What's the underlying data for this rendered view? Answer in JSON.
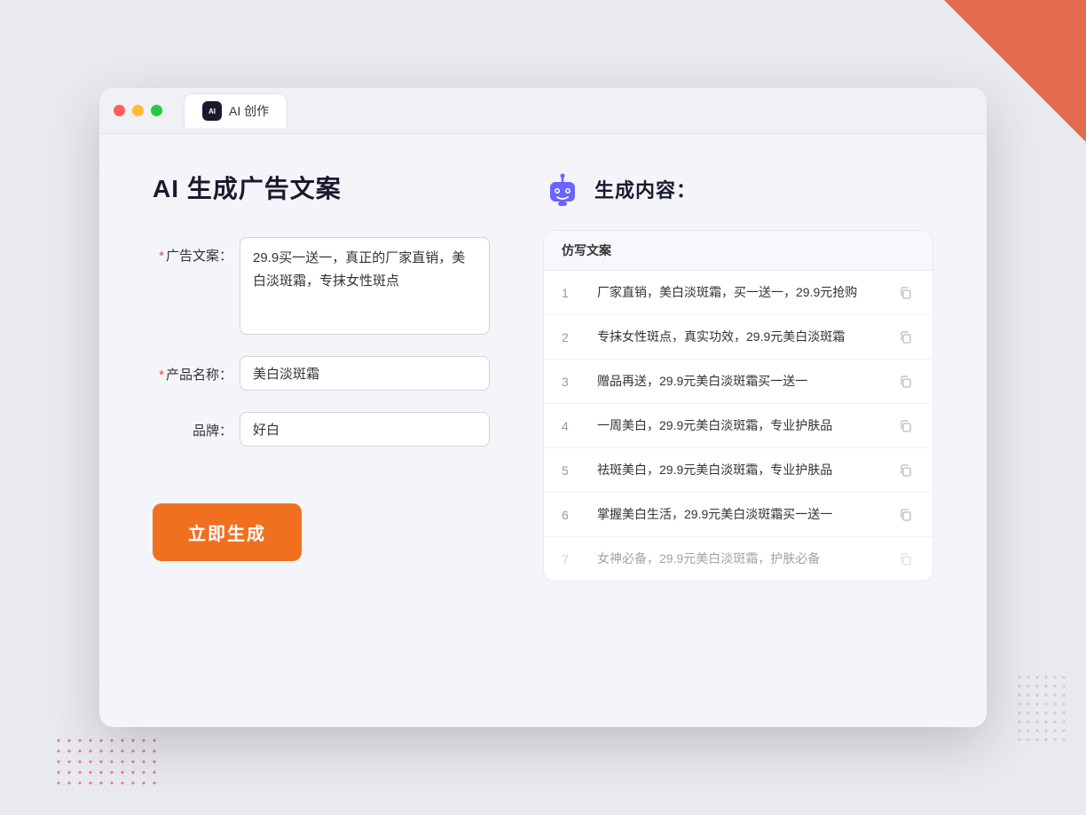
{
  "window": {
    "tab_label": "AI 创作"
  },
  "page": {
    "title": "AI 生成广告文案"
  },
  "form": {
    "ad_copy_label": "广告文案：",
    "ad_copy_required": true,
    "ad_copy_value": "29.9买一送一，真正的厂家直销，美白淡斑霜，专抹女性斑点",
    "product_name_label": "产品名称：",
    "product_name_required": true,
    "product_name_value": "美白淡斑霜",
    "brand_label": "品牌：",
    "brand_required": false,
    "brand_value": "好白",
    "generate_btn_label": "立即生成"
  },
  "results": {
    "header_title": "生成内容：",
    "column_label": "仿写文案",
    "items": [
      {
        "num": 1,
        "text": "厂家直销，美白淡斑霜，买一送一，29.9元抢购",
        "faded": false
      },
      {
        "num": 2,
        "text": "专抹女性斑点，真实功效，29.9元美白淡斑霜",
        "faded": false
      },
      {
        "num": 3,
        "text": "赠品再送，29.9元美白淡斑霜买一送一",
        "faded": false
      },
      {
        "num": 4,
        "text": "一周美白，29.9元美白淡斑霜，专业护肤品",
        "faded": false
      },
      {
        "num": 5,
        "text": "祛斑美白，29.9元美白淡斑霜，专业护肤品",
        "faded": false
      },
      {
        "num": 6,
        "text": "掌握美白生活，29.9元美白淡斑霜买一送一",
        "faded": false
      },
      {
        "num": 7,
        "text": "女神必备，29.9元美白淡斑霜，护肤必备",
        "faded": true
      }
    ]
  },
  "colors": {
    "accent_orange": "#f07020",
    "required_red": "#e05533",
    "brand_bg": "#1a1a2e"
  }
}
